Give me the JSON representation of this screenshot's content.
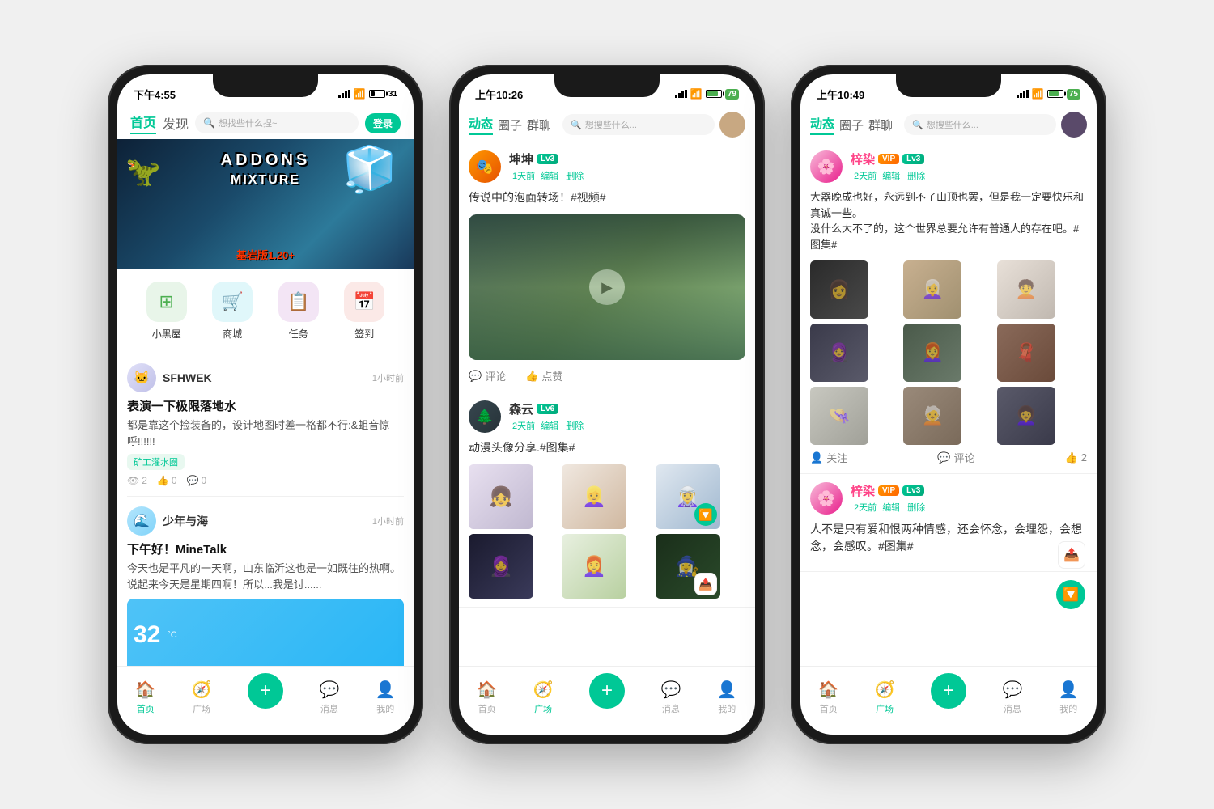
{
  "phones": [
    {
      "id": "phone1",
      "statusBar": {
        "time": "下午4:55",
        "batteryPercent": 31
      },
      "nav": {
        "tabs": [
          "首页",
          "发现"
        ],
        "activeTab": "首页",
        "searchPlaceholder": "想找些什么捏~",
        "loginLabel": "登录"
      },
      "banner": {
        "title": "ADDONS",
        "subtitle": "MIXTURE",
        "version": "基岩版1.20+"
      },
      "quickActions": [
        {
          "label": "小黑屋",
          "color": "#4caf50",
          "icon": "⊞"
        },
        {
          "label": "商城",
          "color": "#26c6da",
          "icon": "🛒"
        },
        {
          "label": "任务",
          "color": "#ab47bc",
          "icon": "📋"
        },
        {
          "label": "签到",
          "color": "#ff7043",
          "icon": "📅"
        }
      ],
      "feed": [
        {
          "username": "SFHWEK",
          "time": "1小时前",
          "title": "表演一下极限落地水",
          "content": "都是靠这个捡装备的，设计地图时差一格都不行:&蛆音惊呼!!!!!!",
          "tag": "矿工灌水圈",
          "stats": {
            "views": "2",
            "likes": "0",
            "comments": "0"
          }
        },
        {
          "username": "少年与海",
          "time": "1小时前",
          "title": "下午好！MineTalk",
          "content": "今天也是平凡的一天啊，山东临沂这也是一如既往的热啊。说起来今天是星期四啊！所以...我是讨......",
          "hasImage": true
        }
      ],
      "bottomNav": [
        "首页",
        "广场",
        "",
        "消息",
        "我的"
      ],
      "activeBottomNav": "首页"
    },
    {
      "id": "phone2",
      "statusBar": {
        "time": "上午10:26",
        "batteryPercent": 79
      },
      "nav": {
        "tabs": [
          "动态",
          "圈子",
          "群聊"
        ],
        "activeTab": "动态",
        "searchPlaceholder": "想搜些什么..."
      },
      "posts": [
        {
          "username": "坤坤",
          "level": "Lv3",
          "time": "1天前",
          "actions": [
            "编辑",
            "删除"
          ],
          "text": "传说中的泡面转场！#视频#",
          "hasVideo": true,
          "videoActions": [
            "评论",
            "点赞"
          ]
        },
        {
          "username": "森云",
          "level": "Lv6",
          "time": "2天前",
          "actions": [
            "编辑",
            "删除"
          ],
          "text": "动漫头像分享.#图集#",
          "hasImageGrid": true
        }
      ],
      "bottomNav": [
        "首页",
        "广场",
        "",
        "消息",
        "我的"
      ],
      "activeBottomNav": "广场"
    },
    {
      "id": "phone3",
      "statusBar": {
        "time": "上午10:49",
        "batteryPercent": 75
      },
      "nav": {
        "tabs": [
          "动态",
          "圈子",
          "群聊"
        ],
        "activeTab": "动态",
        "searchPlaceholder": "想搜些什么..."
      },
      "posts": [
        {
          "username": "梓染",
          "level": "Lv3",
          "hasVip": true,
          "time": "2天前",
          "actions": [
            "编辑",
            "删除"
          ],
          "text": "大器晚成也好，永远到不了山顶也罢，但是我一定要快乐和真诚一些。\n没什么大不了的，这个世界总要允许有普通人的存在吧。#图集#",
          "hasPhotoGrid": true,
          "postActions": {
            "follow": "关注",
            "comment": "评论",
            "likes": "2"
          }
        },
        {
          "username": "梓染",
          "level": "Lv3",
          "hasVip": true,
          "time": "2天前",
          "actions": [
            "编辑",
            "删除"
          ],
          "text": "人不是只有爱和恨两种情感，还会怀念，会埋怨，会想念，会感叹。#图集#"
        }
      ],
      "bottomNav": [
        "首页",
        "广场",
        "",
        "消息",
        "我的"
      ],
      "activeBottomNav": "广场"
    }
  ]
}
